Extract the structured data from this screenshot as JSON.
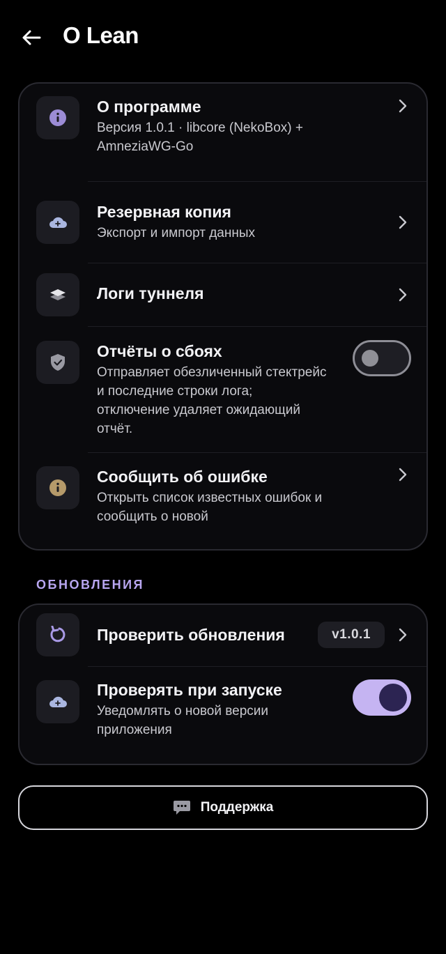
{
  "header": {
    "title": "O Lean",
    "back_icon": "arrow-left-icon"
  },
  "main_card": {
    "items": [
      {
        "title": "О программе",
        "subtitle": "Версия 1.0.1 · libcore (NekoBox) + AmneziaWG-Go",
        "icon": "info-icon",
        "icon_color": "#9c8cd6",
        "control": "chevron"
      },
      {
        "title": "Резервная копия",
        "subtitle": "Экспорт и импорт данных",
        "icon": "cloud-icon",
        "icon_color": "#aab6e0",
        "control": "chevron"
      },
      {
        "title": "Логи туннеля",
        "subtitle": "",
        "icon": "layers-icon",
        "icon_color": "#e6e6ea",
        "control": "chevron"
      },
      {
        "title": "Отчёты о сбоях",
        "subtitle": "Отправляет обезличенный стектрейс и последние строки лога; отключение удаляет ожидающий отчёт.",
        "icon": "shield-check-icon",
        "icon_color": "#9a9aa3",
        "control": "toggle",
        "toggle_on": false
      },
      {
        "title": "Сообщить об ошибке",
        "subtitle": "Открыть список известных ошибок и сообщить о новой",
        "icon": "alert-info-icon",
        "icon_color": "#b59a6a",
        "control": "chevron"
      }
    ]
  },
  "updates_section": {
    "label": "ОБНОВЛЕНИЯ",
    "items": [
      {
        "title": "Проверить обновления",
        "badge": "v1.0.1",
        "icon": "refresh-icon",
        "icon_color": "#a99ae6",
        "control": "chevron"
      },
      {
        "title": "Проверять при запуске",
        "subtitle": "Уведомлять о новой версии приложения",
        "icon": "cloud-icon",
        "icon_color": "#aab6e0",
        "control": "toggle",
        "toggle_on": true
      }
    ]
  },
  "support_button": {
    "label": "Поддержка",
    "icon": "chat-bubble-icon"
  },
  "colors": {
    "background": "#000000",
    "card_background": "#0a0a0d",
    "card_border": "#2a2a31",
    "accent": "#c5b4f2",
    "accent_dark": "#2c2452",
    "section_label": "#b8a6f0"
  }
}
